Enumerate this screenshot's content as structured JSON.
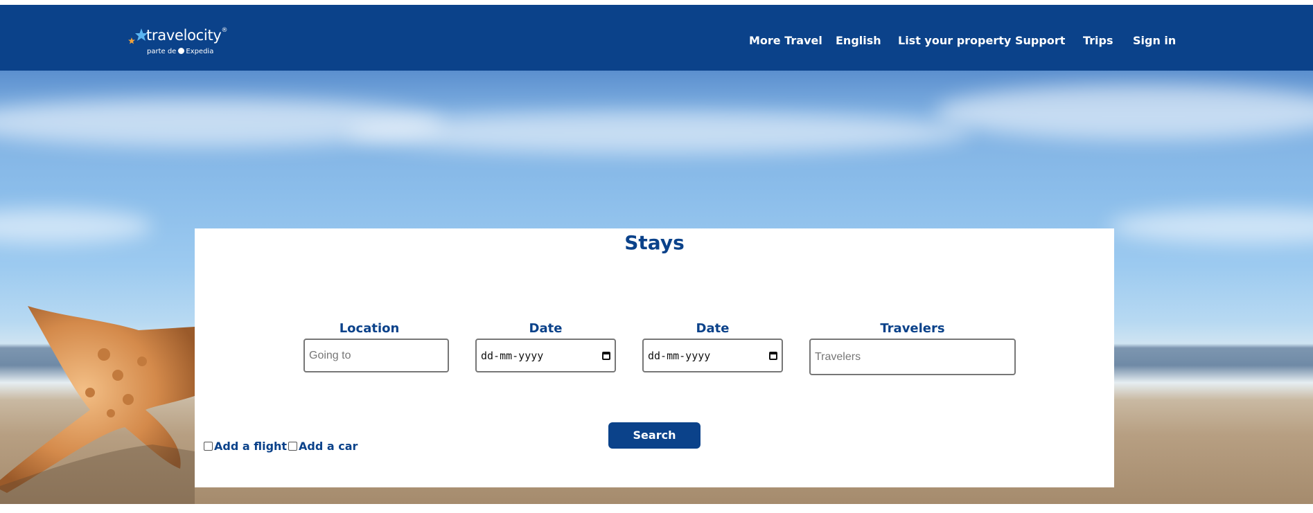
{
  "brand": {
    "name": "travelocity",
    "trademark": "®",
    "tagline_prefix": "parte de",
    "tagline_brand": "Expedia",
    "accent_color": "#0b428a"
  },
  "nav": {
    "more_travel": "More Travel",
    "language": "English",
    "list_property": "List your property",
    "support": "Support",
    "trips": "Trips",
    "sign_in": "Sign in"
  },
  "stays": {
    "title": "Stays",
    "location_label": "Location",
    "location_placeholder": "Going to",
    "checkin_label": "Date",
    "checkin_value": "dd-mm-yyyy",
    "checkout_label": "Date",
    "checkout_value": "dd-mm-yyyy",
    "travelers_label": "Travelers",
    "travelers_placeholder": "Travelers",
    "search_label": "Search",
    "add_flight_label": "Add a flight",
    "add_car_label": "Add a car"
  },
  "icons": {
    "logo": "travelocity-star-icon",
    "calendar": "calendar-icon"
  }
}
